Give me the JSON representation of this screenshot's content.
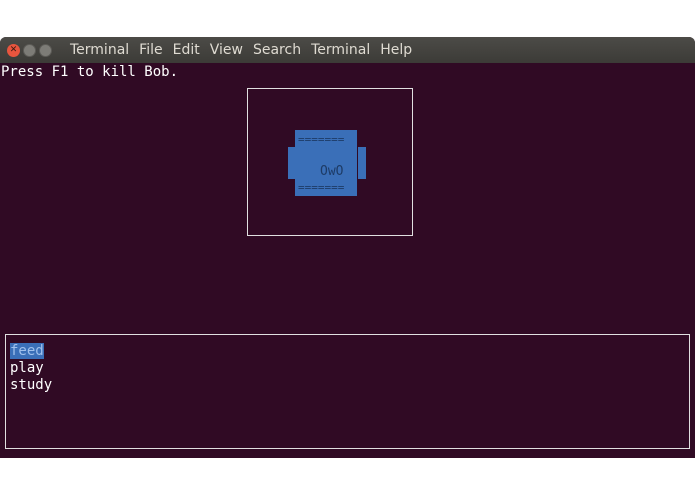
{
  "window": {
    "menu": [
      "Terminal",
      "File",
      "Edit",
      "View",
      "Search",
      "Terminal",
      "Help"
    ]
  },
  "terminal": {
    "hint": "Press F1 to kill Bob.",
    "pet": {
      "top": "=======",
      "face": "OwO",
      "bottom": "=======",
      "color": "#3a6fb8"
    },
    "actions": [
      {
        "label": "feed",
        "selected": true
      },
      {
        "label": "play",
        "selected": false
      },
      {
        "label": "study",
        "selected": false
      }
    ]
  }
}
